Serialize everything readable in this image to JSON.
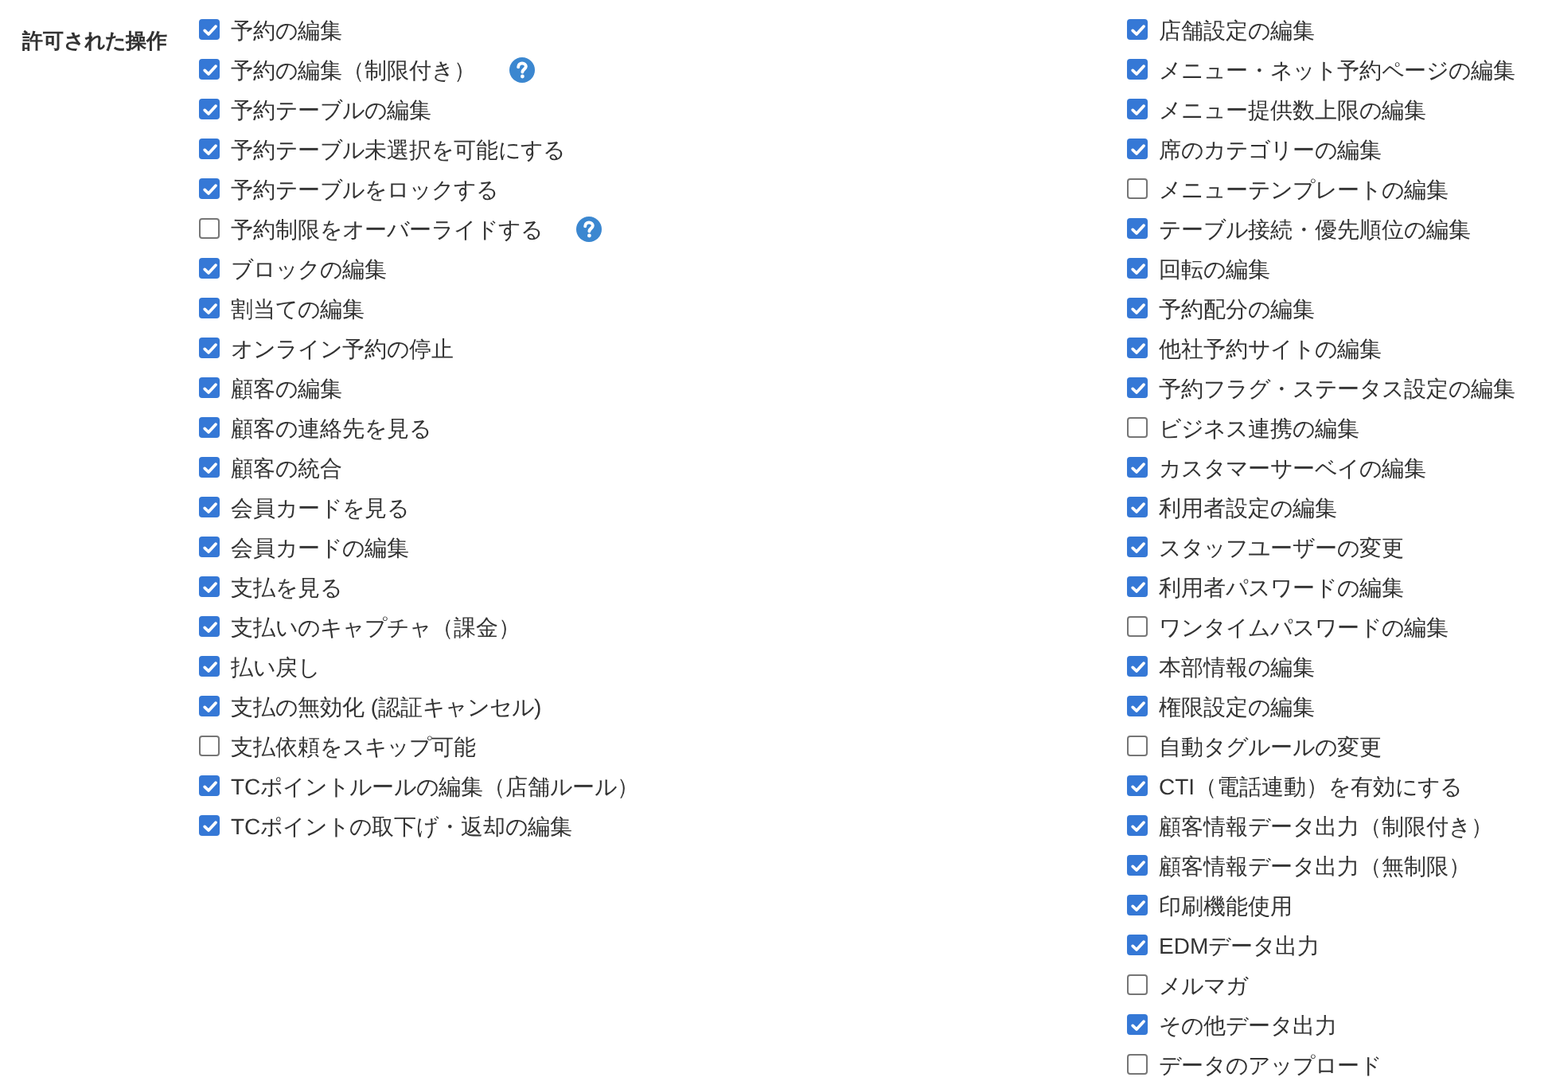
{
  "section": {
    "label": "許可された操作"
  },
  "columns": [
    {
      "items": [
        {
          "label": "予約の編集",
          "checked": true
        },
        {
          "label": "予約の編集（制限付き）",
          "checked": true,
          "help": true
        },
        {
          "label": "予約テーブルの編集",
          "checked": true
        },
        {
          "label": "予約テーブル未選択を可能にする",
          "checked": true
        },
        {
          "label": "予約テーブルをロックする",
          "checked": true
        },
        {
          "label": "予約制限をオーバーライドする",
          "checked": false,
          "help": true
        },
        {
          "label": "ブロックの編集",
          "checked": true
        },
        {
          "label": "割当ての編集",
          "checked": true
        },
        {
          "label": "オンライン予約の停止",
          "checked": true
        },
        {
          "label": "顧客の編集",
          "checked": true
        },
        {
          "label": "顧客の連絡先を見る",
          "checked": true
        },
        {
          "label": "顧客の統合",
          "checked": true
        },
        {
          "label": "会員カードを見る",
          "checked": true
        },
        {
          "label": "会員カードの編集",
          "checked": true
        },
        {
          "label": "支払を見る",
          "checked": true
        },
        {
          "label": "支払いのキャプチャ（課金）",
          "checked": true
        },
        {
          "label": "払い戻し",
          "checked": true
        },
        {
          "label": "支払の無効化 (認証キャンセル)",
          "checked": true
        },
        {
          "label": "支払依頼をスキップ可能",
          "checked": false
        },
        {
          "label": "TCポイントルールの編集（店舗ルール）",
          "checked": true
        },
        {
          "label": "TCポイントの取下げ・返却の編集",
          "checked": true
        }
      ]
    },
    {
      "items": [
        {
          "label": "店舗設定の編集",
          "checked": true
        },
        {
          "label": "メニュー・ネット予約ページの編集",
          "checked": true
        },
        {
          "label": "メニュー提供数上限の編集",
          "checked": true
        },
        {
          "label": "席のカテゴリーの編集",
          "checked": true
        },
        {
          "label": "メニューテンプレートの編集",
          "checked": false
        },
        {
          "label": "テーブル接続・優先順位の編集",
          "checked": true
        },
        {
          "label": "回転の編集",
          "checked": true
        },
        {
          "label": "予約配分の編集",
          "checked": true
        },
        {
          "label": "他社予約サイトの編集",
          "checked": true
        },
        {
          "label": "予約フラグ・ステータス設定の編集",
          "checked": true
        },
        {
          "label": "ビジネス連携の編集",
          "checked": false
        },
        {
          "label": "カスタマーサーベイの編集",
          "checked": true
        },
        {
          "label": "利用者設定の編集",
          "checked": true
        },
        {
          "label": "スタッフユーザーの変更",
          "checked": true
        },
        {
          "label": "利用者パスワードの編集",
          "checked": true
        },
        {
          "label": "ワンタイムパスワードの編集",
          "checked": false
        },
        {
          "label": "本部情報の編集",
          "checked": true
        },
        {
          "label": "権限設定の編集",
          "checked": true
        },
        {
          "label": "自動タグルールの変更",
          "checked": false
        },
        {
          "label": "CTI（電話連動）を有効にする",
          "checked": true
        },
        {
          "label": "顧客情報データ出力（制限付き）",
          "checked": true
        },
        {
          "label": "顧客情報データ出力（無制限）",
          "checked": true
        },
        {
          "label": "印刷機能使用",
          "checked": true
        },
        {
          "label": "EDMデータ出力",
          "checked": true
        },
        {
          "label": "メルマガ",
          "checked": false
        },
        {
          "label": "その他データ出力",
          "checked": true
        },
        {
          "label": "データのアップロード",
          "checked": false
        }
      ]
    }
  ]
}
